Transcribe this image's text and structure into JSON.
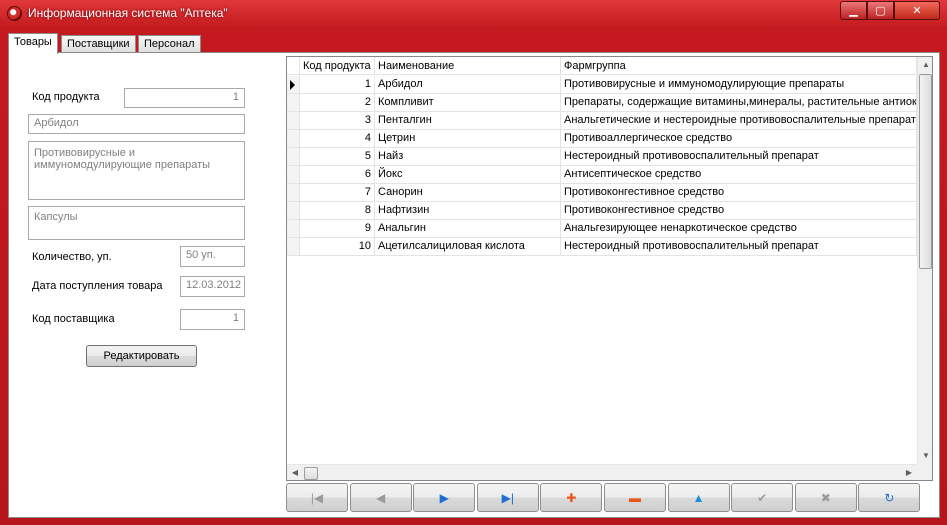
{
  "window": {
    "title": "Информационная система \"Аптека\""
  },
  "tabs": [
    {
      "label": "Товары",
      "active": true
    },
    {
      "label": "Поставщики",
      "active": false
    },
    {
      "label": "Персонал",
      "active": false
    }
  ],
  "form": {
    "product_code_label": "Код продукта",
    "product_code_value": "1",
    "name_value": "Арбидол",
    "group_value": "Противовирусные и иммуномодулирующие препараты",
    "form_value": "Капсулы",
    "quantity_label": "Количество, уп.",
    "quantity_value": "50 уп.",
    "arrival_date_label": "Дата поступления товара",
    "arrival_date_value": "12.03.2012",
    "supplier_code_label": "Код поставщика",
    "supplier_code_value": "1",
    "edit_button": "Редактировать"
  },
  "grid": {
    "columns": [
      "Код продукта",
      "Наименование",
      "Фармгруппа"
    ],
    "rows": [
      {
        "code": "1",
        "name": "Арбидол",
        "group": "Противовирусные и иммуномодулирующие препараты",
        "current": true
      },
      {
        "code": "2",
        "name": "Компливит",
        "group": "Препараты, содержащие витамины,минералы, растительные антиоксиданты"
      },
      {
        "code": "3",
        "name": "Пенталгин",
        "group": "Анальгетические и нестероидные противовоспалительные препараты"
      },
      {
        "code": "4",
        "name": "Цетрин",
        "group": "Противоаллергическое средство"
      },
      {
        "code": "5",
        "name": "Найз",
        "group": "Нестероидный противовоспалительный препарат"
      },
      {
        "code": "6",
        "name": "Йокс",
        "group": "Антисептическое средство"
      },
      {
        "code": "7",
        "name": "Санорин",
        "group": "Противоконгестивное средство"
      },
      {
        "code": "8",
        "name": "Нафтизин",
        "group": "Противоконгестивное средство"
      },
      {
        "code": "9",
        "name": "Анальгин",
        "group": "Анальгезирующее ненаркотическое средство"
      },
      {
        "code": "10",
        "name": "Ацетилсалициловая кислота",
        "group": "Нестероидный противовоспалительный препарат"
      }
    ]
  },
  "navigator": [
    {
      "name": "first-record",
      "glyph": "|◀",
      "color": "#9a9a9a"
    },
    {
      "name": "prior-record",
      "glyph": "◀",
      "color": "#9a9a9a"
    },
    {
      "name": "next-record",
      "glyph": "▶",
      "color": "#1e6fd0"
    },
    {
      "name": "last-record",
      "glyph": "▶|",
      "color": "#1e6fd0"
    },
    {
      "name": "insert-record",
      "glyph": "✚",
      "color": "#e8561a"
    },
    {
      "name": "delete-record",
      "glyph": "▬",
      "color": "#e8561a"
    },
    {
      "name": "edit-record",
      "glyph": "▲",
      "color": "#1e8fd0"
    },
    {
      "name": "post-record",
      "glyph": "✔",
      "color": "#9a9a9a"
    },
    {
      "name": "cancel-record",
      "glyph": "✖",
      "color": "#9a9a9a"
    },
    {
      "name": "refresh-records",
      "glyph": "↻",
      "color": "#1e6fd0"
    }
  ]
}
